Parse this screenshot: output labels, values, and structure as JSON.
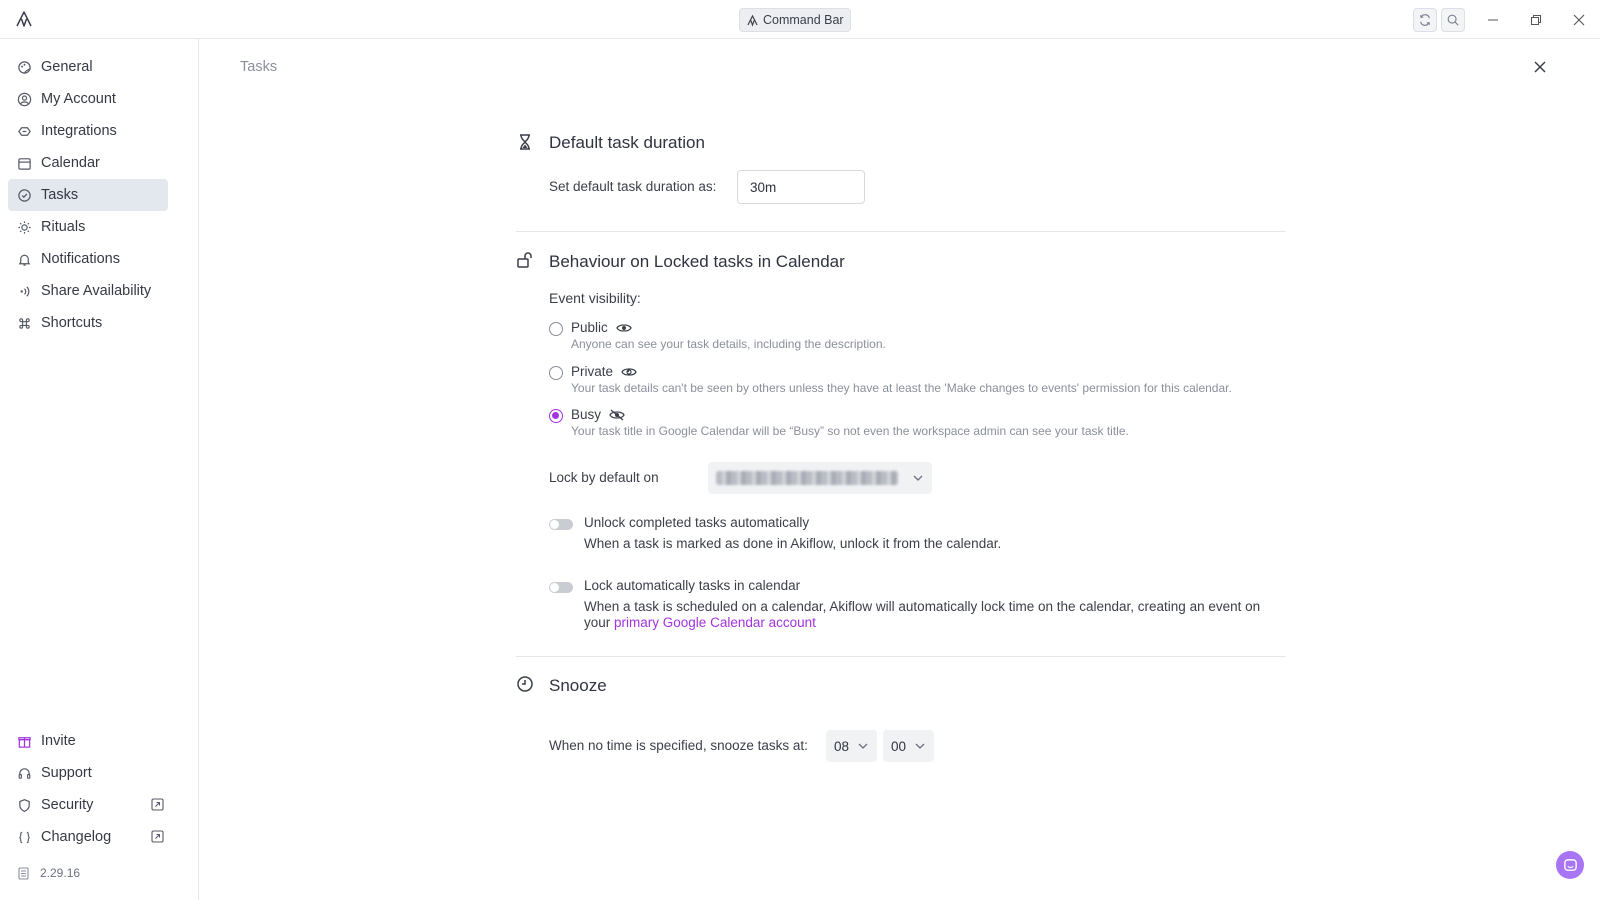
{
  "titlebar": {
    "command_bar_label": "Command Bar"
  },
  "sidebar": {
    "items": [
      {
        "label": "General",
        "icon": "palette-icon"
      },
      {
        "label": "My Account",
        "icon": "user-circle-icon"
      },
      {
        "label": "Integrations",
        "icon": "integrations-icon"
      },
      {
        "label": "Calendar",
        "icon": "calendar-icon"
      },
      {
        "label": "Tasks",
        "icon": "check-circle-icon",
        "active": true
      },
      {
        "label": "Rituals",
        "icon": "sun-icon"
      },
      {
        "label": "Notifications",
        "icon": "bell-icon"
      },
      {
        "label": "Share Availability",
        "icon": "broadcast-icon"
      },
      {
        "label": "Shortcuts",
        "icon": "command-icon"
      }
    ],
    "bottom_items": [
      {
        "label": "Invite",
        "icon": "gift-icon"
      },
      {
        "label": "Support",
        "icon": "headset-icon"
      },
      {
        "label": "Security",
        "icon": "shield-icon"
      },
      {
        "label": "Changelog",
        "icon": "braces-icon"
      }
    ],
    "version": "2.29.16"
  },
  "main": {
    "breadcrumb": "Tasks",
    "duration": {
      "title": "Default task duration",
      "label": "Set default task duration as:",
      "value": "30m"
    },
    "locked": {
      "title": "Behaviour on Locked tasks in Calendar",
      "visibility_label": "Event visibility:",
      "options": [
        {
          "label": "Public",
          "desc": "Anyone can see your task details, including the description.",
          "checked": false
        },
        {
          "label": "Private",
          "desc": "Your task details can't be seen by others unless they have at least the 'Make changes to events' permission for this calendar.",
          "checked": false
        },
        {
          "label": "Busy",
          "desc": "Your task title in Google Calendar will be “Busy” so not even the workspace admin can see your task title.",
          "checked": true
        }
      ],
      "lock_default_label": "Lock by default on",
      "unlock_title": "Unlock completed tasks automatically",
      "unlock_desc": "When a task is marked as done in Akiflow, unlock it from the calendar.",
      "autolock_title": "Lock automatically tasks in calendar",
      "autolock_desc_1": "When a task is scheduled on a calendar, Akiflow will automatically lock time on the calendar, creating an event on",
      "autolock_desc_2": "your",
      "autolock_link": "primary Google Calendar account"
    },
    "snooze": {
      "title": "Snooze",
      "label": "When no time is specified, snooze tasks at:",
      "hour": "08",
      "minute": "00"
    }
  },
  "colors": {
    "accent": "#a233e0",
    "active_nav_bg": "#e3e7ee"
  }
}
